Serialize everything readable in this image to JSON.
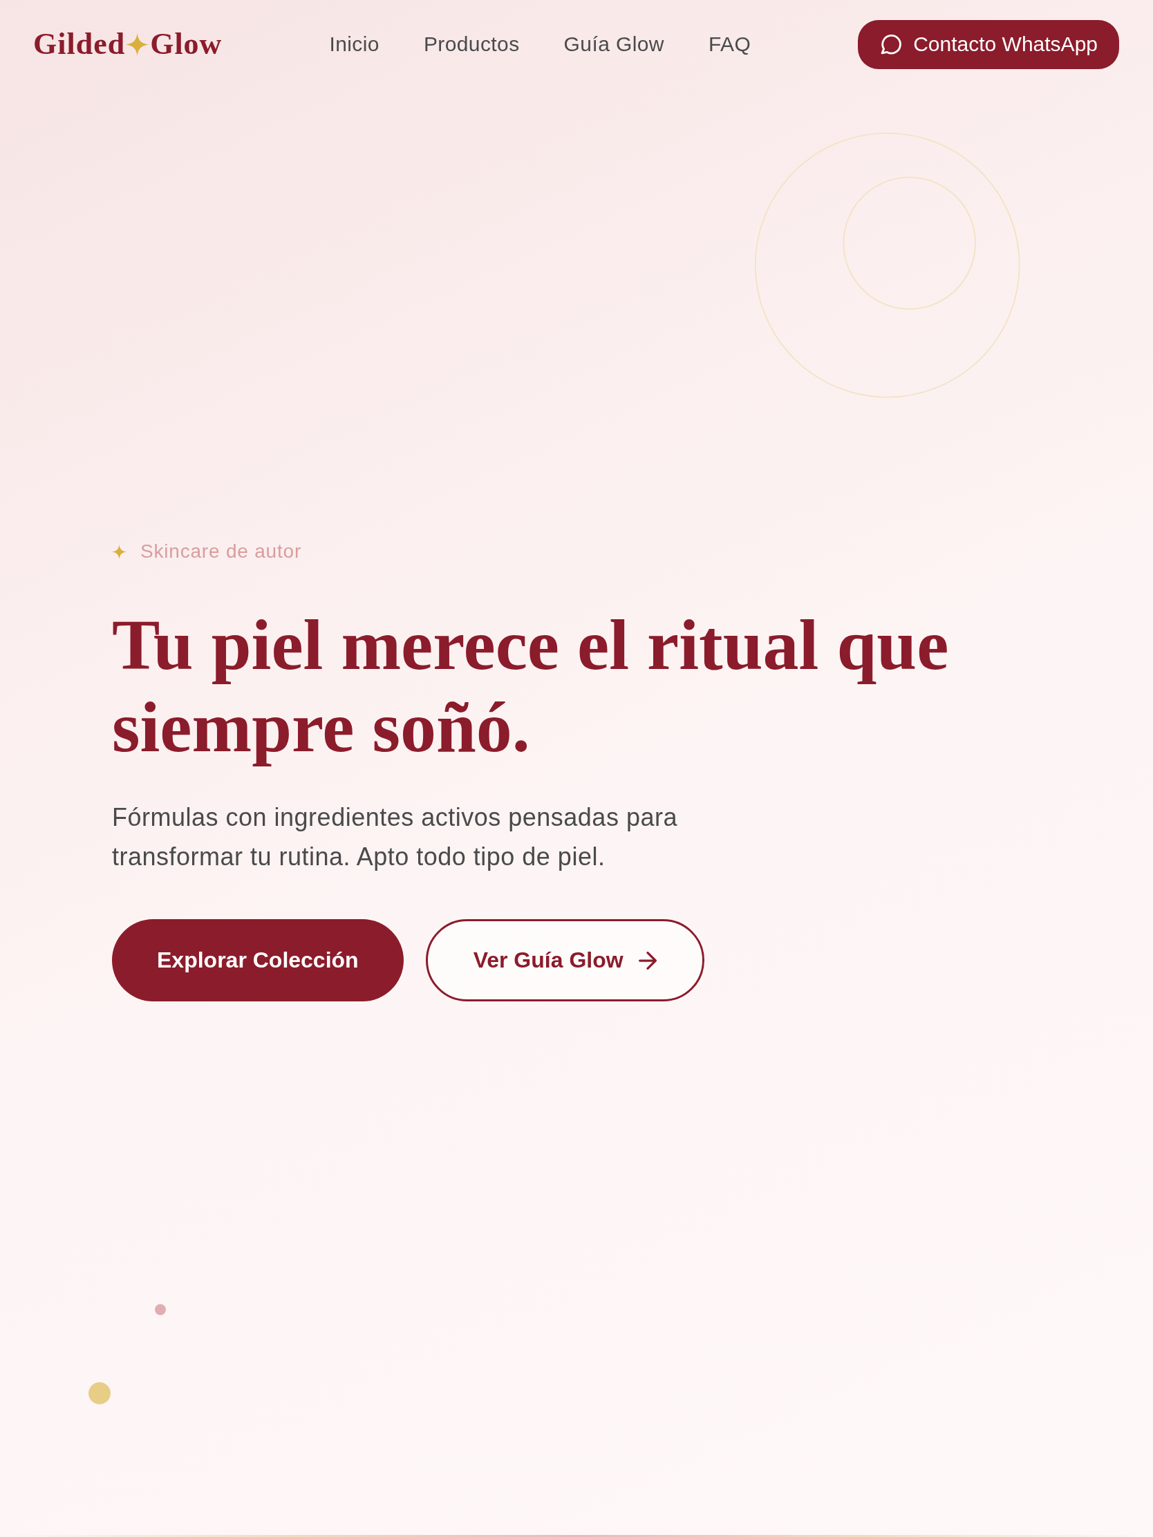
{
  "header": {
    "brand": {
      "words": [
        "Gilded",
        "Glow"
      ]
    },
    "nav": [
      "Inicio",
      "Productos",
      "Guía Glow",
      "FAQ"
    ],
    "cta": {
      "label": "Contacto WhatsApp"
    }
  },
  "hero": {
    "eyebrow": "Skincare de autor",
    "title": "Tu piel merece el ritual que siempre soñó.",
    "description": "Fórmulas con ingredientes activos pensadas para transformar tu rutina. Apto todo tipo de piel.",
    "buttons": [
      {
        "label": "Explorar Colección",
        "kind": "primary"
      },
      {
        "label": "Ver Guía Glow",
        "kind": "outline"
      }
    ]
  }
}
